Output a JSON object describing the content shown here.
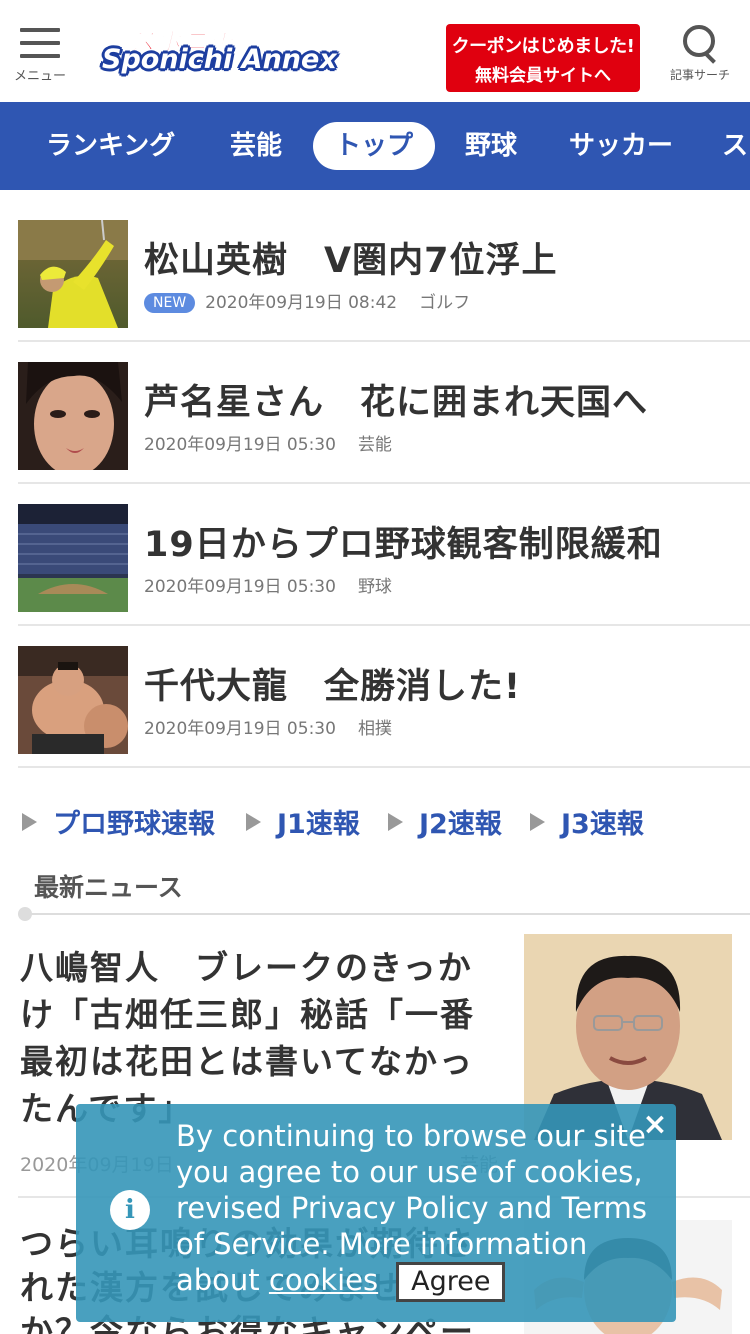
{
  "header": {
    "menu_label": "メニュー",
    "logo_top": "スポニチ",
    "logo_main": "Sponichi Annex",
    "coupon_line1": "クーポンはじめました!",
    "coupon_line2": "無料会員サイトへ",
    "search_label": "記事サーチ"
  },
  "nav": {
    "items": [
      {
        "label": "ランキング"
      },
      {
        "label": "芸能"
      },
      {
        "label": "トップ",
        "active": true
      },
      {
        "label": "野球"
      },
      {
        "label": "サッカー"
      },
      {
        "label": "ス"
      }
    ]
  },
  "top_articles": [
    {
      "title": "松山英樹　V圏内7位浮上",
      "badge": "NEW",
      "date": "2020年09月19日 08:42",
      "category": "ゴルフ",
      "thumb_icon": "golfer-photo"
    },
    {
      "title": "芦名星さん　花に囲まれ天国へ",
      "date": "2020年09月19日 05:30",
      "category": "芸能",
      "thumb_icon": "portrait-photo"
    },
    {
      "title": "19日からプロ野球観客制限緩和",
      "date": "2020年09月19日 05:30",
      "category": "野球",
      "thumb_icon": "stadium-photo"
    },
    {
      "title": "千代大龍　全勝消した!",
      "date": "2020年09月19日 05:30",
      "category": "相撲",
      "thumb_icon": "sumo-photo"
    }
  ],
  "quick_links": [
    "プロ野球速報",
    "J1速報",
    "J2速報",
    "J3速報"
  ],
  "latest": {
    "heading": "最新ニュース",
    "items": [
      {
        "title": "八嶋智人　ブレークのきっかけ「古畑任三郎」秘話「一番最初は花田とは書いてなかったんです」",
        "date": "2020年09月19日",
        "category": "芸能"
      },
      {
        "title": "つらい耳鳴りの効果が期待された漢方を試してみませんか？今ならお得なキャンペーン中",
        "date": "",
        "category": ""
      }
    ]
  },
  "cookie": {
    "text": "By continuing to browse our site you agree to our use of cookies, revised Privacy Policy and Terms of Service. More information about",
    "link": "cookies",
    "agree": "Agree",
    "close": "×",
    "info": "i"
  },
  "colors": {
    "brand_blue": "#2f56b2",
    "brand_red": "#e0000f",
    "badge_blue": "#5d8be0",
    "cookie_bg": "#3596b8"
  }
}
